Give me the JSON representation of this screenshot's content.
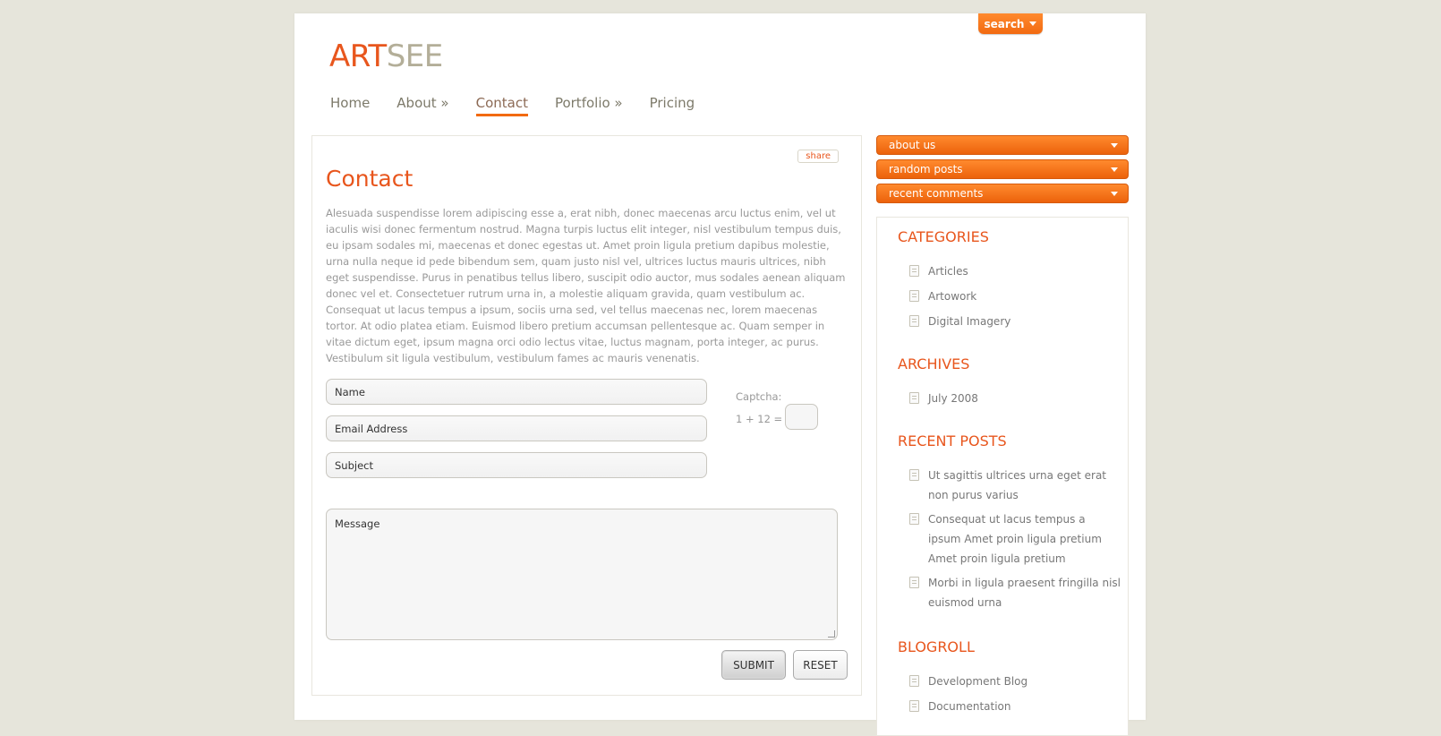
{
  "header": {
    "search_label": "search",
    "logo_part1": "ART",
    "logo_part2": "SEE",
    "logo_color1": "#e8561d",
    "logo_color2": "#b3ae98"
  },
  "nav": {
    "items": [
      {
        "label": "Home"
      },
      {
        "label": "About »"
      },
      {
        "label": "Contact",
        "active": true
      },
      {
        "label": "Portfolio »"
      },
      {
        "label": "Pricing"
      }
    ]
  },
  "main": {
    "share_label": "share",
    "title": "Contact",
    "body": "Alesuada suspendisse lorem adipiscing esse a, erat nibh, donec maecenas arcu luctus enim, vel ut iaculis wisi donec fermentum nostrud. Magna turpis luctus elit integer, nisl vestibulum tempus duis, eu ipsam sodales mi, maecenas et donec egestas ut. Amet proin ligula pretium dapibus molestie, urna nulla neque id pede bibendum sem, quam justo nisl vel, ultrices luctus mauris ultrices, nibh eget suspendisse. Purus in penatibus tellus libero, suscipit odio auctor, mus sodales aenean aliquam donec vel et. Consectetuer rutrum urna in, a molestie aliquam gravida, quam vestibulum ac. Consequat ut lacus tempus a ipsum, sociis urna sed, vel tellus maecenas nec, lorem maecenas tortor. At odio platea etiam. Euismod libero pretium accumsan pellentesque ac. Quam semper in vitae dictum eget, ipsum magna orci odio lectus vitae, luctus magnam, porta integer, ac purus. Vestibulum sit ligula vestibulum, vestibulum fames ac mauris venenatis."
  },
  "form": {
    "name_value": "Name",
    "email_value": "Email Address",
    "subject_value": "Subject",
    "message_value": "Message",
    "captcha_label": "Captcha:",
    "captcha_equation": "1 + 12 =",
    "captcha_value": "",
    "submit_label": "SUBMIT",
    "reset_label": "RESET"
  },
  "widgets": {
    "about_us": "about us",
    "random_posts": "random posts",
    "recent_comments": "recent comments"
  },
  "sidebar": {
    "categories_title": "CATEGORIES",
    "categories": [
      "Articles",
      "Artowork",
      "Digital Imagery"
    ],
    "archives_title": "ARCHIVES",
    "archives": [
      "July 2008"
    ],
    "recent_posts_title": "RECENT POSTS",
    "recent_posts": [
      "Ut sagittis ultrices urna eget erat non purus varius",
      "Consequat ut lacus tempus a ipsum Amet proin ligula pretium Amet proin ligula pretium",
      "Morbi in ligula praesent fringilla nisl euismod urna"
    ],
    "blogroll_title": "BLOGROLL",
    "blogroll": [
      "Development Blog",
      "Documentation"
    ]
  },
  "colors": {
    "accent": "#f26a11",
    "heading": "#e8561d",
    "background": "#e6e5db"
  }
}
